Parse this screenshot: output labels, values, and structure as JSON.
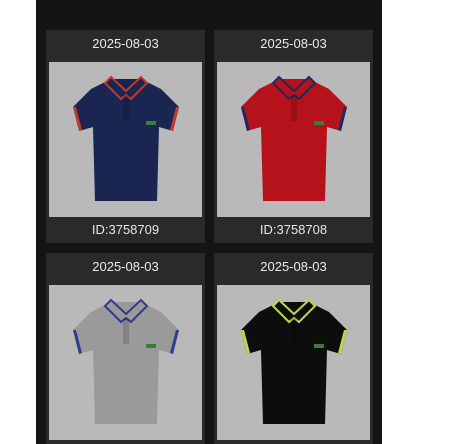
{
  "products": [
    {
      "date": "2025-08-03",
      "id_label": "ID:3758709",
      "shirt_color": "#1b2552",
      "trim_color": "#c0392b",
      "collar_inner": "#1b2552"
    },
    {
      "date": "2025-08-03",
      "id_label": "ID:3758708",
      "shirt_color": "#b5121b",
      "trim_color": "#1e2a5e",
      "collar_inner": "#b5121b"
    },
    {
      "date": "2025-08-03",
      "id_label": "",
      "shirt_color": "#9a9a9a",
      "trim_color": "#2c3e8c",
      "collar_inner": "#9a9a9a"
    },
    {
      "date": "2025-08-03",
      "id_label": "",
      "shirt_color": "#0d0d0d",
      "trim_color": "#b7d94a",
      "collar_inner": "#0d0d0d"
    }
  ]
}
